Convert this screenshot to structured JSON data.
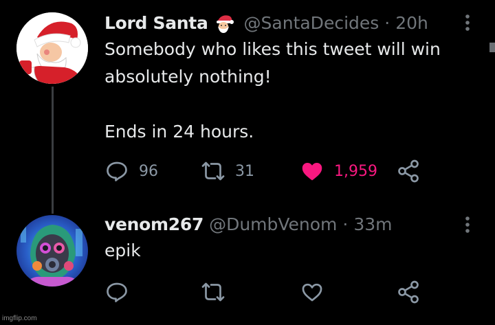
{
  "tweets": [
    {
      "name": "Lord Santa",
      "name_emoji_icon": "santa-emoji-icon",
      "handle": "@SantaDecides",
      "separator": "·",
      "time": "20h",
      "text": "Somebody who likes this tweet will win absolutely nothing!\n\nEnds in 24 hours.",
      "actions": {
        "reply_count": "96",
        "retweet_count": "31",
        "like_count": "1,959",
        "liked": true
      }
    },
    {
      "name": "venom267",
      "handle": "@DumbVenom",
      "separator": "·",
      "time": "33m",
      "text": "epik",
      "actions": {
        "reply_count": "",
        "retweet_count": "",
        "like_count": "",
        "liked": false
      }
    }
  ],
  "colors": {
    "background": "#000000",
    "text_primary": "#e7e9ea",
    "text_secondary": "#71767b",
    "icon_gray": "#8b98a5",
    "like_pink": "#f91880",
    "thread_line": "#3a3d41"
  },
  "watermark": "imgflip.com"
}
